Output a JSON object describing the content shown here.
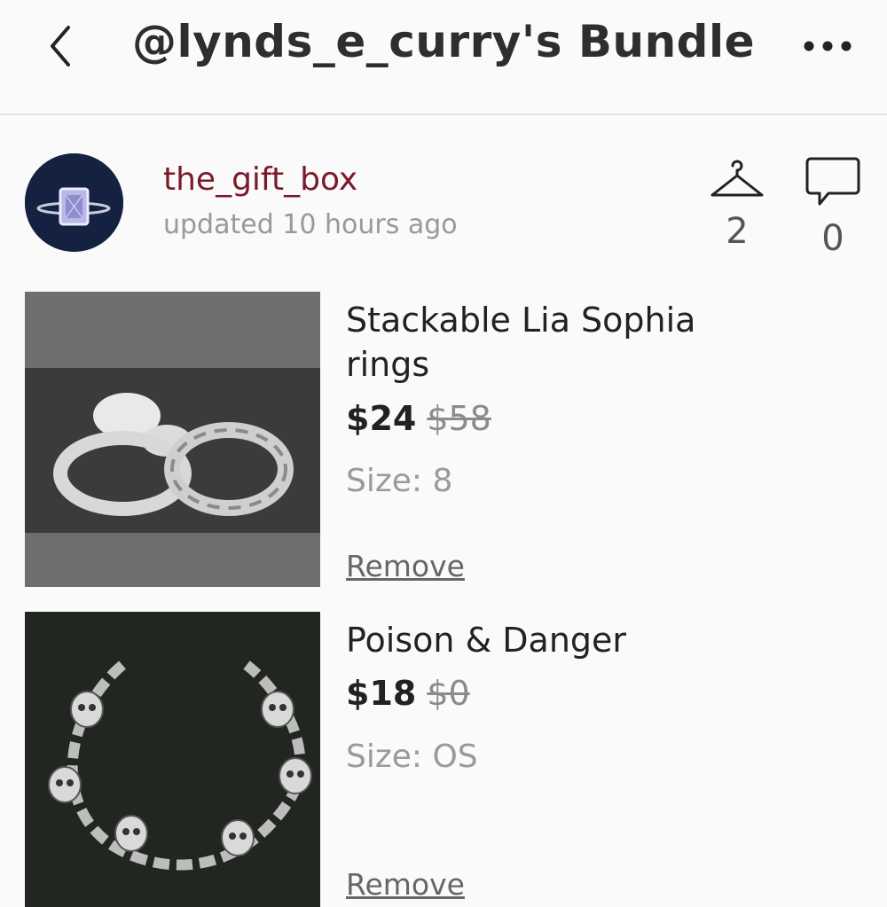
{
  "header": {
    "title": "@lynds_e_curry's Bundle",
    "back_icon": "chevron-left-icon",
    "more_icon": "more-horizontal-icon"
  },
  "seller": {
    "username": "the_gift_box",
    "updated": "updated 10 hours ago",
    "likes_count": "2",
    "comments_count": "0"
  },
  "items": [
    {
      "title": "Stackable Lia Sophia rings",
      "price": "$24",
      "original_price": "$58",
      "size": "Size: 8",
      "remove_label": "Remove"
    },
    {
      "title": "Poison & Danger",
      "price": "$18",
      "original_price": "$0",
      "size": "Size: OS",
      "remove_label": "Remove"
    }
  ],
  "colors": {
    "username": "#7a1a2a",
    "background": "#fafafa",
    "divider": "#e4e4e4"
  }
}
